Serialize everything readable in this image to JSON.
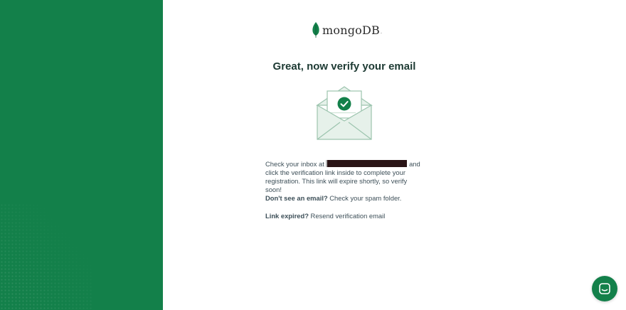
{
  "brand": {
    "logo_text": "mongoDB",
    "logo_trademark": ".",
    "leaf_color": "#13804a"
  },
  "side_panel": {
    "color": "#13804a"
  },
  "heading": "Great, now verify your email",
  "illustration": {
    "icon": "envelope-with-check-icon"
  },
  "instructions": {
    "part1": "Check your inbox at ",
    "part2": " and click the verification link inside to complete your registration. This link will expire shortly, so verify soon!"
  },
  "spam_hint": {
    "label": "Don't see an email?",
    "text": " Check your spam folder."
  },
  "resend": {
    "label": "Link expired?",
    "link": " Resend verification email"
  },
  "chat": {
    "icon": "chat-icon",
    "color": "#13804a"
  }
}
